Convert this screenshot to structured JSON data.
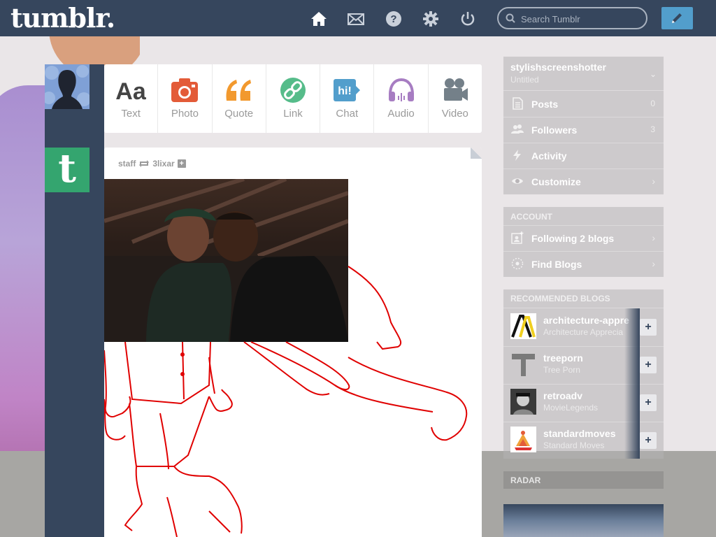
{
  "topbar": {
    "logo": "tumblr.",
    "search_placeholder": "Search Tumblr",
    "nav_icons": [
      "home-icon",
      "mail-icon",
      "help-icon",
      "gear-icon",
      "power-icon"
    ]
  },
  "post_types": [
    {
      "label": "Text",
      "icon": "text-icon",
      "color": "#444444"
    },
    {
      "label": "Photo",
      "icon": "camera-icon",
      "color": "#e35b38"
    },
    {
      "label": "Quote",
      "icon": "quote-icon",
      "color": "#f2992e"
    },
    {
      "label": "Link",
      "icon": "link-icon",
      "color": "#56bc8a"
    },
    {
      "label": "Chat",
      "icon": "chat-icon",
      "color": "#529ecc"
    },
    {
      "label": "Audio",
      "icon": "headphones-icon",
      "color": "#a77dc2"
    },
    {
      "label": "Video",
      "icon": "video-camera-icon",
      "color": "#748089"
    }
  ],
  "post": {
    "author": "staff",
    "reblogged_from": "3lixar"
  },
  "sidebar": {
    "blog_name": "stylishscreenshotter",
    "blog_subtitle": "Untitled",
    "rows": [
      {
        "label": "Posts",
        "count": "0"
      },
      {
        "label": "Followers",
        "count": "3"
      },
      {
        "label": "Activity",
        "count": ""
      },
      {
        "label": "Customize",
        "count": ""
      }
    ],
    "account_title": "ACCOUNT",
    "account_rows": [
      {
        "label": "Following 2 blogs"
      },
      {
        "label": "Find Blogs"
      }
    ],
    "recommended_title": "RECOMMENDED BLOGS",
    "recommended": [
      {
        "name": "architecture-appre",
        "subtitle": "Architecture Apprecia"
      },
      {
        "name": "treeporn",
        "subtitle": "Tree Porn"
      },
      {
        "name": "retroadv",
        "subtitle": "MovieLegends"
      },
      {
        "name": "standardmoves",
        "subtitle": "Standard Moves"
      }
    ],
    "radar_title": "RADAR"
  },
  "colors": {
    "topbar": "#36465d",
    "accent": "#529ecc",
    "drawing": "#e00000"
  }
}
